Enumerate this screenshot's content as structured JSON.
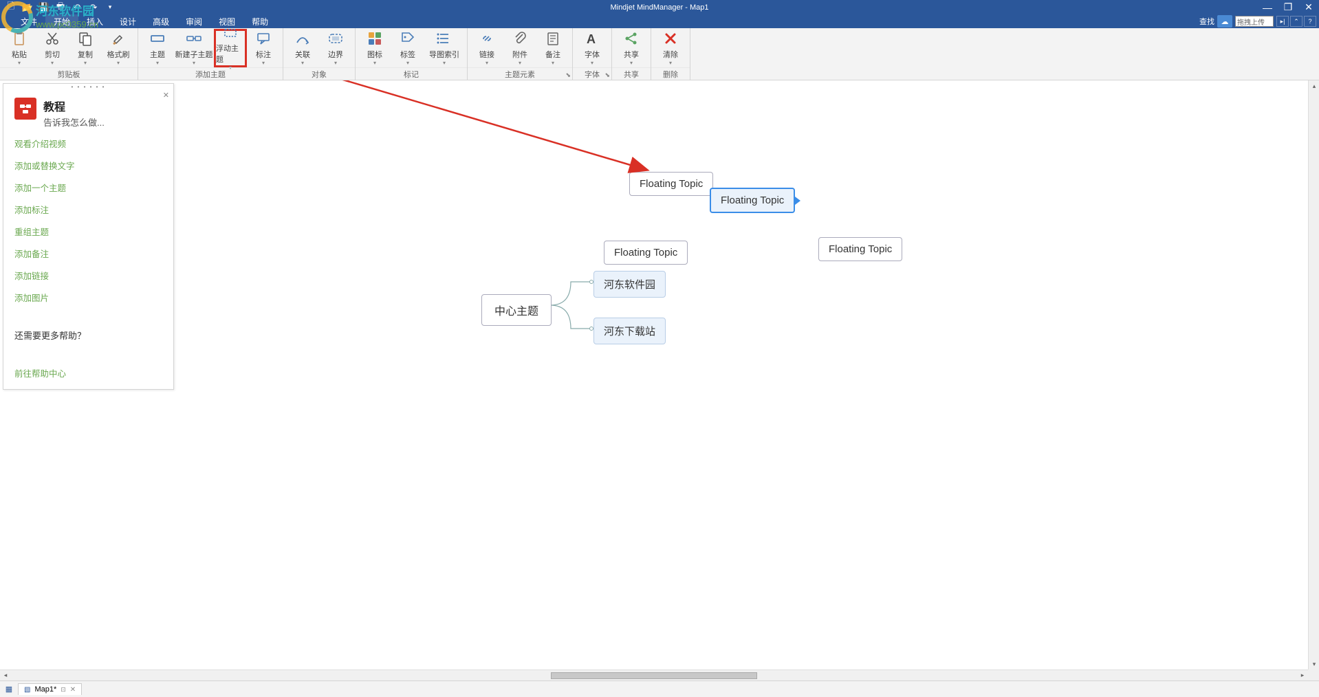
{
  "title": "Mindjet MindManager - Map1",
  "watermark": {
    "line1": "河东软件园",
    "line2": "www.pc0359.cn"
  },
  "menus": [
    "文件",
    "开始",
    "插入",
    "设计",
    "高级",
    "审阅",
    "视图",
    "帮助"
  ],
  "search": {
    "label": "查找",
    "placeholder": "拖拽上传"
  },
  "ribbon": {
    "groups": [
      {
        "label": "剪贴板",
        "buttons": [
          {
            "id": "paste",
            "label": "粘贴",
            "icon": "clipboard"
          },
          {
            "id": "cut",
            "label": "剪切",
            "icon": "scissors"
          },
          {
            "id": "copy",
            "label": "复制",
            "icon": "copy"
          },
          {
            "id": "format-painter",
            "label": "格式刷",
            "icon": "brush"
          }
        ]
      },
      {
        "label": "添加主题",
        "buttons": [
          {
            "id": "topic",
            "label": "主题",
            "icon": "topic"
          },
          {
            "id": "subtopic",
            "label": "新建子主题",
            "icon": "subtopic",
            "wide": true
          },
          {
            "id": "floating",
            "label": "浮动主题",
            "icon": "floating",
            "highlighted": true
          },
          {
            "id": "callout",
            "label": "标注",
            "icon": "callout"
          }
        ]
      },
      {
        "label": "对象",
        "buttons": [
          {
            "id": "relationship",
            "label": "关联",
            "icon": "relationship"
          },
          {
            "id": "boundary",
            "label": "边界",
            "icon": "boundary"
          }
        ]
      },
      {
        "label": "标记",
        "buttons": [
          {
            "id": "icons",
            "label": "图标",
            "icon": "icons"
          },
          {
            "id": "tags",
            "label": "标签",
            "icon": "tags"
          },
          {
            "id": "map-index",
            "label": "导图索引",
            "icon": "index",
            "wide": true
          }
        ]
      },
      {
        "label": "主题元素",
        "buttons": [
          {
            "id": "link",
            "label": "链接",
            "icon": "link"
          },
          {
            "id": "attachment",
            "label": "附件",
            "icon": "attachment"
          },
          {
            "id": "note",
            "label": "备注",
            "icon": "note"
          }
        ],
        "launcher": true
      },
      {
        "label": "字体",
        "buttons": [
          {
            "id": "font",
            "label": "字体",
            "icon": "font"
          }
        ],
        "launcher": true
      },
      {
        "label": "共享",
        "buttons": [
          {
            "id": "share",
            "label": "共享",
            "icon": "share"
          }
        ]
      },
      {
        "label": "删除",
        "buttons": [
          {
            "id": "clear",
            "label": "清除",
            "icon": "clear"
          }
        ]
      }
    ]
  },
  "taskpane": {
    "title": "教程",
    "subtitle": "告诉我怎么做...",
    "links": [
      "观看介绍视频",
      "添加或替换文字",
      "添加一个主题",
      "添加标注",
      "重组主题",
      "添加备注",
      "添加链接",
      "添加图片"
    ],
    "help_question": "还需要更多帮助？",
    "help_link": "前往帮助中心"
  },
  "map": {
    "central": "中心主题",
    "sub1": "河东软件园",
    "sub2": "河东下载站",
    "float1": "Floating Topic",
    "float2": "Floating Topic",
    "float3": "Floating Topic",
    "float4": "Floating Topic"
  },
  "doc_tab": "Map1*"
}
